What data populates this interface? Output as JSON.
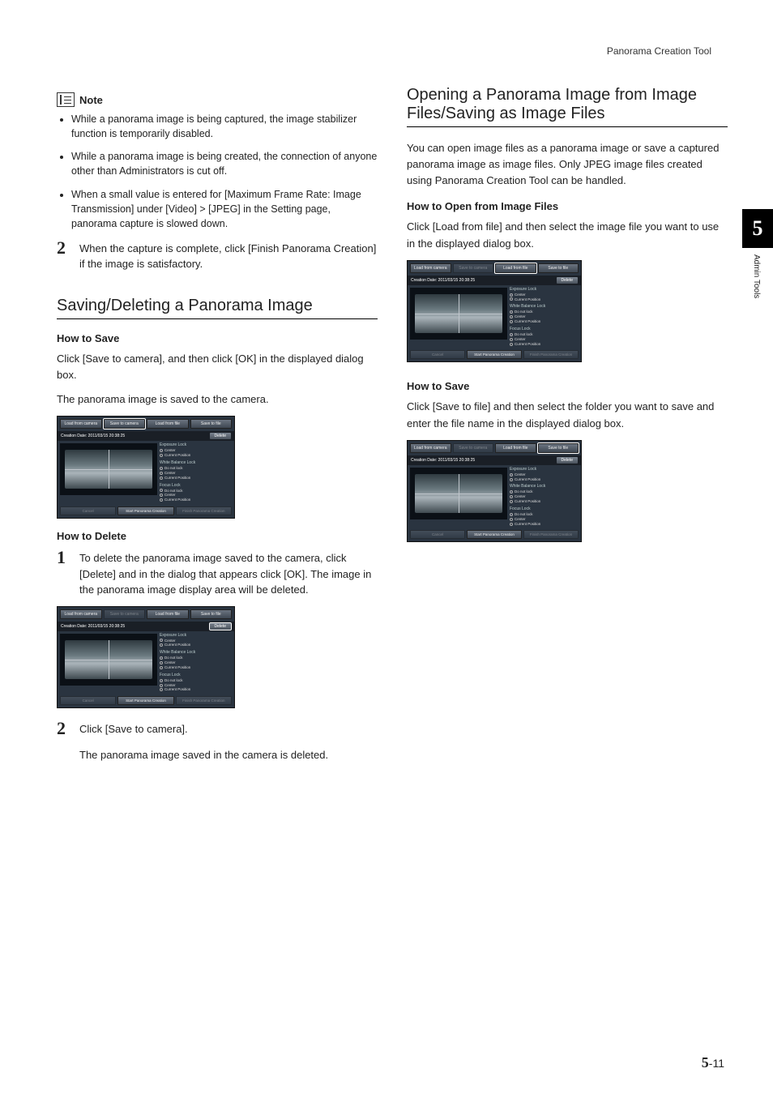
{
  "header": {
    "running": "Panorama Creation Tool"
  },
  "sidetab": {
    "number": "5",
    "label": "Admin Tools"
  },
  "left": {
    "note_label": "Note",
    "bullets": [
      "While a panorama image is being captured, the image stabilizer function is temporarily disabled.",
      "While a panorama image is being created, the connection of anyone other than Administrators is cut off.",
      "When a small value is entered for [Maximum Frame Rate: Image Transmission] under [Video] > [JPEG] in the Setting page, panorama capture is slowed down."
    ],
    "step2": "When the capture is complete, click [Finish Panorama Creation] if the image is satisfactory.",
    "section_saving": "Saving/Deleting a Panorama Image",
    "how_save": "How to Save",
    "save_p1": "Click [Save to camera], and then click [OK] in the displayed dialog box.",
    "save_p2": "The panorama image is saved to the camera.",
    "how_delete": "How to Delete",
    "del_step1": "To delete the panorama image saved to the camera, click [Delete] and in the dialog that appears click [OK]. The image in the panorama image display area will be deleted.",
    "del_step2": "Click [Save to camera].",
    "del_p3": "The panorama image saved in the camera is deleted."
  },
  "right": {
    "section_open": "Opening a Panorama Image from Image Files/Saving as Image Files",
    "intro": "You can open image files as a panorama image or save a captured panorama image as image files. Only JPEG image files created using Panorama Creation Tool can be handled.",
    "how_open": "How to Open from Image Files",
    "open_p": "Click [Load from file] and then select the image file you want to use in the displayed dialog box.",
    "how_save": "How to Save",
    "save_p": "Click [Save to file] and then select the folder you want to save and enter the file name in the displayed dialog box."
  },
  "shot": {
    "btn_load_cam": "Load from camera",
    "btn_save_cam": "Save to camera",
    "btn_load_file": "Load from file",
    "btn_save_file": "Save to file",
    "date": "Creation Date: 2011/03/15 20:38:25",
    "delete": "Delete",
    "exposure": "Exposure Lock",
    "wb": "White Balance Lock",
    "focus": "Focus Lock",
    "opt_nolock": "Do not lock",
    "opt_center": "Center",
    "opt_current": "Current Position",
    "cancel": "Cancel",
    "start": "Start Panorama Creation",
    "finish": "Finish Panorama Creation"
  },
  "footer": {
    "chapter": "5",
    "page": "11"
  }
}
